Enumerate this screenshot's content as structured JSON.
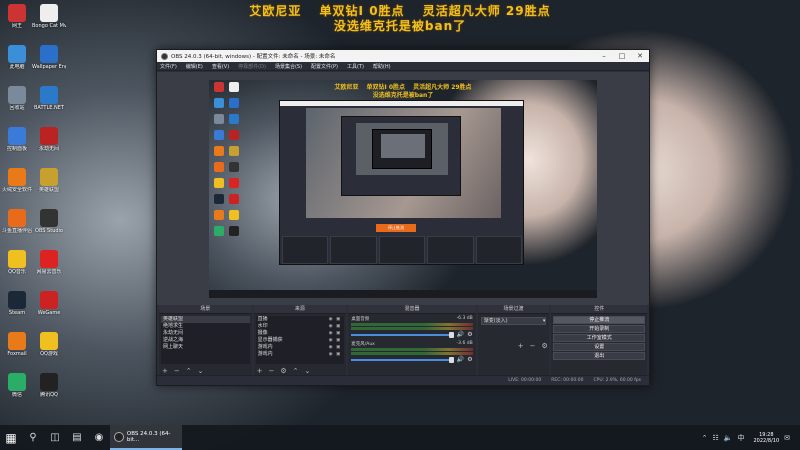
{
  "overlay": {
    "line1": "艾欧尼亚　 单双钻I 0胜点　 灵活超凡大师 29胜点",
    "line2": "没选维克托是被ban了"
  },
  "desktop_icons": [
    {
      "label": "网王",
      "color": "#c33"
    },
    {
      "label": "Bongo Cat Mver",
      "color": "#eee"
    },
    {
      "label": "此电脑",
      "color": "#3a8fd8"
    },
    {
      "label": "Wallpaper Engine",
      "color": "#2a6fc9"
    },
    {
      "label": "回收站",
      "color": "#7a8a9a"
    },
    {
      "label": "BATTLE.NET",
      "color": "#2a7ac9"
    },
    {
      "label": "控制面板",
      "color": "#3a7ad8"
    },
    {
      "label": "永劫无间",
      "color": "#b22"
    },
    {
      "label": "火绒安全软件",
      "color": "#e87a1a"
    },
    {
      "label": "英雄联盟",
      "color": "#c8a030"
    },
    {
      "label": "斗鱼直播伴侣",
      "color": "#e86a1a"
    },
    {
      "label": "OBS Studio",
      "color": "#333"
    },
    {
      "label": "QQ音乐",
      "color": "#f0c020"
    },
    {
      "label": "网易云音乐",
      "color": "#d22"
    },
    {
      "label": "Steam",
      "color": "#1b2838"
    },
    {
      "label": "WeGame",
      "color": "#c22"
    },
    {
      "label": "Foxmail",
      "color": "#e87a1a"
    },
    {
      "label": "QQ游戏",
      "color": "#f0c020"
    },
    {
      "label": "微信",
      "color": "#2aae67"
    },
    {
      "label": "腾讯QQ",
      "color": "#222"
    }
  ],
  "obs": {
    "title": "OBS 24.0.3 (64-bit, windows) - 配置文件: 未命名 - 场景: 未命名",
    "menu": [
      {
        "label": "文件(F)",
        "enabled": true
      },
      {
        "label": "编辑(E)",
        "enabled": true
      },
      {
        "label": "查看(V)",
        "enabled": true
      },
      {
        "label": "停靠部件(D)",
        "enabled": false
      },
      {
        "label": "场景集合(S)",
        "enabled": true
      },
      {
        "label": "配置文件(P)",
        "enabled": true
      },
      {
        "label": "工具(T)",
        "enabled": true
      },
      {
        "label": "帮助(H)",
        "enabled": true
      }
    ],
    "preview": {
      "overlay_line1": "艾欧尼亚　 单双钻I 0胜点　 灵活超凡大师 29胜点",
      "overlay_line2": "没选维克托是被ban了",
      "nested_button": "停止推流",
      "nested_title": "OBS 24.0.3 (64-bit, windows)"
    },
    "docks": {
      "scenes": {
        "header": "场景",
        "items": [
          "英雄联盟",
          "绝地求生",
          "永劫无间",
          "逆战之海",
          "网上聊天"
        ],
        "selected": 0
      },
      "sources": {
        "header": "来源",
        "items": [
          "直播",
          "水印",
          "摄像",
          "显示器捕获",
          "游戏内",
          "游戏内"
        ]
      },
      "mixer": {
        "header": "混音器",
        "tracks": [
          {
            "name": "桌面音频",
            "db": "-6.3 dB"
          },
          {
            "name": "麦克风/Aux",
            "db": "-3.6 dB"
          }
        ]
      },
      "transitions": {
        "header": "场景过渡",
        "selected": "渐变(淡入)"
      },
      "controls": {
        "header": "控件",
        "buttons": [
          "停止推流",
          "开始录制",
          "工作室模式",
          "设置",
          "退出"
        ],
        "active": 0
      }
    },
    "status": {
      "live": "LIVE: 00:00:00",
      "rec": "REC: 00:00:00",
      "cpu": "CPU: 2.9%, 60.00 fps"
    }
  },
  "taskbar": {
    "app_label": "OBS 24.0.3 (64-bit...",
    "time": "19:28",
    "date": "2022/8/10"
  }
}
